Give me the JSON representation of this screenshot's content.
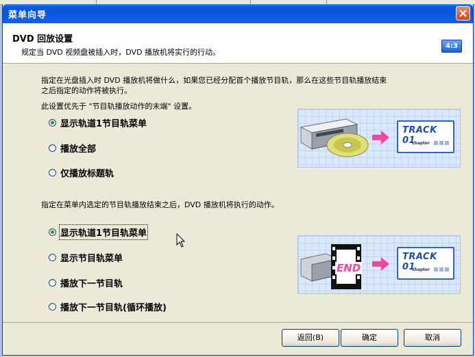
{
  "window": {
    "title": "菜单向导"
  },
  "header": {
    "title": "DVD 回放设置",
    "subtitle": "规定当 DVD 视频盘被插入时，DVD 播放机将实行的行动。",
    "ratio_badge": "4:3"
  },
  "section1": {
    "description_line1": "指定在光盘插入时 DVD 播放机将做什么，如果您已经分配首个播放节目轨，那么在这些节目轨播放结束",
    "description_line2": "之后指定的动作将被执行。",
    "priority_note": "此设置优先于 \"节目轨播放动作的末端\" 设置。",
    "options": [
      {
        "label": "显示轨道1节目轨菜单",
        "checked": true
      },
      {
        "label": "播放全部",
        "checked": false
      },
      {
        "label": "仅播放标题轨",
        "checked": false
      }
    ],
    "illustration": {
      "track_text": "TRACK 01",
      "chapter_text": "chapter"
    }
  },
  "section2": {
    "description": "指定在菜单内选定的节目轨播放结束之后，DVD 播放机将执行的动作。",
    "options": [
      {
        "label": "显示轨道1节目轨菜单",
        "checked": true
      },
      {
        "label": "显示节目轨菜单",
        "checked": false
      },
      {
        "label": "播放下一节目轨",
        "checked": false
      },
      {
        "label": "播放下一节目轨(循环播放)",
        "checked": false
      }
    ],
    "illustration": {
      "end_text": "END",
      "track_text": "TRACK 01",
      "chapter_text": "chapter"
    }
  },
  "footer": {
    "back_label": "返回(B)",
    "ok_label": "确定",
    "cancel_label": "取消"
  },
  "colors": {
    "titlebar": "#0a54d8",
    "accent_arrow": "#f0489a",
    "track_text": "#1a4ea8",
    "radio_dot": "#21a121"
  }
}
